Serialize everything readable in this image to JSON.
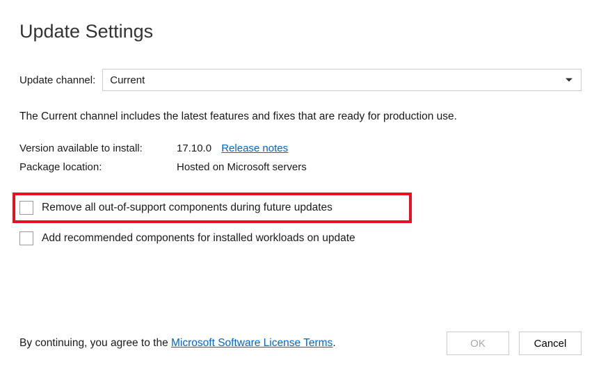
{
  "title": "Update Settings",
  "channel": {
    "label": "Update channel:",
    "selected": "Current"
  },
  "description": "The Current channel includes the latest features and fixes that are ready for production use.",
  "info": {
    "versionLabel": "Version available to install:",
    "versionValue": "17.10.0",
    "releaseNotesLink": "Release notes",
    "packageLabel": "Package location:",
    "packageValue": "Hosted on Microsoft servers"
  },
  "options": {
    "removeOutOfSupport": "Remove all out-of-support components during future updates",
    "addRecommended": "Add recommended components for installed workloads on update"
  },
  "footer": {
    "agreePrefix": "By continuing, you agree to the ",
    "licenseLink": "Microsoft Software License Terms",
    "agreeSuffix": ".",
    "okLabel": "OK",
    "cancelLabel": "Cancel"
  }
}
